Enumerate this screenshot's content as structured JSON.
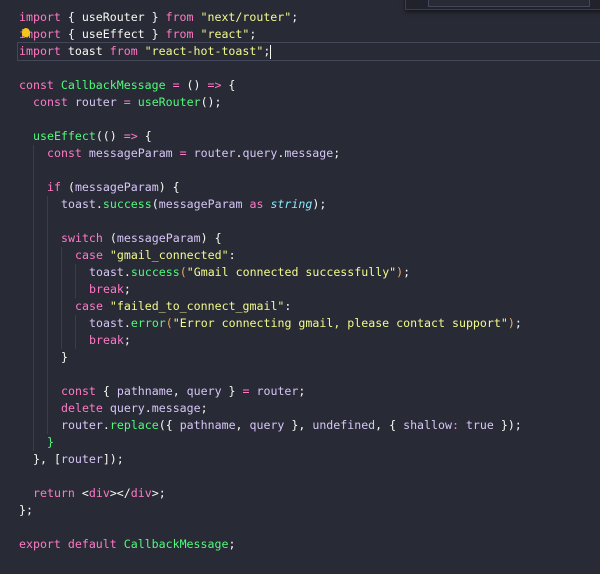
{
  "colors": {
    "background": "#282a36",
    "keyword": "#ff79c6",
    "function": "#50fa7b",
    "string": "#f1fa8c",
    "variable": "#d6c6f5",
    "type": "#8be9fd"
  },
  "icons": {
    "lightbulb": "lightbulb-icon"
  },
  "current_line": 3,
  "lines": [
    {
      "i": 0,
      "t": [
        [
          "k",
          "import"
        ],
        [
          "p",
          " { useRouter } "
        ],
        [
          "k",
          "from"
        ],
        [
          "p",
          " "
        ],
        [
          "s",
          "\"next/router\""
        ],
        [
          "p",
          ";"
        ]
      ]
    },
    {
      "i": 0,
      "t": [
        [
          "k",
          "import"
        ],
        [
          "p",
          " { useEffect } "
        ],
        [
          "k",
          "from"
        ],
        [
          "p",
          " "
        ],
        [
          "s",
          "\"react\""
        ],
        [
          "p",
          ";"
        ]
      ]
    },
    {
      "i": 0,
      "t": [
        [
          "k",
          "import"
        ],
        [
          "p",
          " toast "
        ],
        [
          "k",
          "from"
        ],
        [
          "p",
          " "
        ],
        [
          "s",
          "\"react-hot-toast\""
        ],
        [
          "p",
          ";"
        ]
      ]
    },
    {
      "i": 0,
      "t": []
    },
    {
      "i": 0,
      "t": [
        [
          "k",
          "const"
        ],
        [
          "p",
          " "
        ],
        [
          "f",
          "CallbackMessage"
        ],
        [
          "p",
          " "
        ],
        [
          "k",
          "="
        ],
        [
          "p",
          " () "
        ],
        [
          "k",
          "=>"
        ],
        [
          "p",
          " {"
        ]
      ]
    },
    {
      "i": 1,
      "t": [
        [
          "k",
          "const"
        ],
        [
          "p",
          " "
        ],
        [
          "v",
          "router"
        ],
        [
          "p",
          " "
        ],
        [
          "k",
          "="
        ],
        [
          "p",
          " "
        ],
        [
          "f",
          "useRouter"
        ],
        [
          "p",
          "();"
        ]
      ]
    },
    {
      "i": 1,
      "t": []
    },
    {
      "i": 1,
      "t": [
        [
          "f",
          "useEffect"
        ],
        [
          "p",
          "(() "
        ],
        [
          "k",
          "=>"
        ],
        [
          "p",
          " {"
        ]
      ]
    },
    {
      "i": 2,
      "t": [
        [
          "k",
          "const"
        ],
        [
          "p",
          " "
        ],
        [
          "v",
          "messageParam"
        ],
        [
          "p",
          " "
        ],
        [
          "k",
          "="
        ],
        [
          "p",
          " "
        ],
        [
          "v",
          "router"
        ],
        [
          "p",
          "."
        ],
        [
          "v",
          "query"
        ],
        [
          "p",
          "."
        ],
        [
          "v",
          "message"
        ],
        [
          "p",
          ";"
        ]
      ]
    },
    {
      "i": 2,
      "t": []
    },
    {
      "i": 2,
      "t": [
        [
          "k",
          "if"
        ],
        [
          "p",
          " ("
        ],
        [
          "v",
          "messageParam"
        ],
        [
          "p",
          ") {"
        ]
      ]
    },
    {
      "i": 3,
      "t": [
        [
          "v",
          "toast"
        ],
        [
          "p",
          "."
        ],
        [
          "f",
          "success"
        ],
        [
          "p",
          "("
        ],
        [
          "v",
          "messageParam"
        ],
        [
          "p",
          " "
        ],
        [
          "k",
          "as"
        ],
        [
          "p",
          " "
        ],
        [
          "t",
          "string"
        ],
        [
          "p",
          ");"
        ]
      ]
    },
    {
      "i": 3,
      "t": []
    },
    {
      "i": 3,
      "t": [
        [
          "k",
          "switch"
        ],
        [
          "p",
          " ("
        ],
        [
          "v",
          "messageParam"
        ],
        [
          "p",
          ") {"
        ]
      ]
    },
    {
      "i": 4,
      "t": [
        [
          "k",
          "case"
        ],
        [
          "p",
          " "
        ],
        [
          "s",
          "\"gmail_connected\""
        ],
        [
          "p",
          ":"
        ]
      ]
    },
    {
      "i": 5,
      "t": [
        [
          "v",
          "toast"
        ],
        [
          "p",
          "."
        ],
        [
          "f",
          "success"
        ],
        [
          "b",
          "("
        ],
        [
          "s",
          "\"Gmail connected successfully\""
        ],
        [
          "b",
          ")"
        ],
        [
          "p",
          ";"
        ]
      ]
    },
    {
      "i": 5,
      "t": [
        [
          "k",
          "break"
        ],
        [
          "p",
          ";"
        ]
      ]
    },
    {
      "i": 4,
      "t": [
        [
          "k",
          "case"
        ],
        [
          "p",
          " "
        ],
        [
          "s",
          "\"failed_to_connect_gmail\""
        ],
        [
          "p",
          ":"
        ]
      ]
    },
    {
      "i": 5,
      "t": [
        [
          "v",
          "toast"
        ],
        [
          "p",
          "."
        ],
        [
          "f",
          "error"
        ],
        [
          "b",
          "("
        ],
        [
          "s",
          "\"Error connecting gmail, please contact support\""
        ],
        [
          "b",
          ")"
        ],
        [
          "p",
          ";"
        ]
      ]
    },
    {
      "i": 5,
      "t": [
        [
          "k",
          "break"
        ],
        [
          "p",
          ";"
        ]
      ]
    },
    {
      "i": 3,
      "t": [
        [
          "p",
          "}"
        ]
      ]
    },
    {
      "i": 3,
      "t": []
    },
    {
      "i": 3,
      "t": [
        [
          "k",
          "const"
        ],
        [
          "p",
          " { "
        ],
        [
          "v",
          "pathname"
        ],
        [
          "p",
          ", "
        ],
        [
          "v",
          "query"
        ],
        [
          "p",
          " } "
        ],
        [
          "k",
          "="
        ],
        [
          "p",
          " "
        ],
        [
          "v",
          "router"
        ],
        [
          "p",
          ";"
        ]
      ]
    },
    {
      "i": 3,
      "t": [
        [
          "k",
          "delete"
        ],
        [
          "p",
          " "
        ],
        [
          "v",
          "query"
        ],
        [
          "p",
          "."
        ],
        [
          "v",
          "message"
        ],
        [
          "p",
          ";"
        ]
      ]
    },
    {
      "i": 3,
      "t": [
        [
          "v",
          "router"
        ],
        [
          "p",
          "."
        ],
        [
          "f",
          "replace"
        ],
        [
          "p",
          "({ "
        ],
        [
          "v",
          "pathname"
        ],
        [
          "p",
          ", "
        ],
        [
          "v",
          "query"
        ],
        [
          "p",
          " }, "
        ],
        [
          "v",
          "undefined"
        ],
        [
          "p",
          ", { "
        ],
        [
          "v",
          "shallow"
        ],
        [
          "k",
          ":"
        ],
        [
          "p",
          " "
        ],
        [
          "v",
          "true"
        ],
        [
          "p",
          " });"
        ]
      ]
    },
    {
      "i": 2,
      "t": [
        [
          "f",
          "}"
        ]
      ]
    },
    {
      "i": 1,
      "t": [
        [
          "p",
          "}, ["
        ],
        [
          "v",
          "router"
        ],
        [
          "p",
          "]);"
        ]
      ]
    },
    {
      "i": 1,
      "t": []
    },
    {
      "i": 1,
      "t": [
        [
          "k",
          "return"
        ],
        [
          "p",
          " <"
        ],
        [
          "k",
          "div"
        ],
        [
          "p",
          "></"
        ],
        [
          "k",
          "div"
        ],
        [
          "p",
          ">;"
        ]
      ]
    },
    {
      "i": 0,
      "t": [
        [
          "p",
          "};"
        ]
      ]
    },
    {
      "i": 0,
      "t": []
    },
    {
      "i": 0,
      "t": [
        [
          "k",
          "export"
        ],
        [
          "p",
          " "
        ],
        [
          "k",
          "default"
        ],
        [
          "p",
          " "
        ],
        [
          "f",
          "CallbackMessage"
        ],
        [
          "p",
          ";"
        ]
      ]
    }
  ]
}
